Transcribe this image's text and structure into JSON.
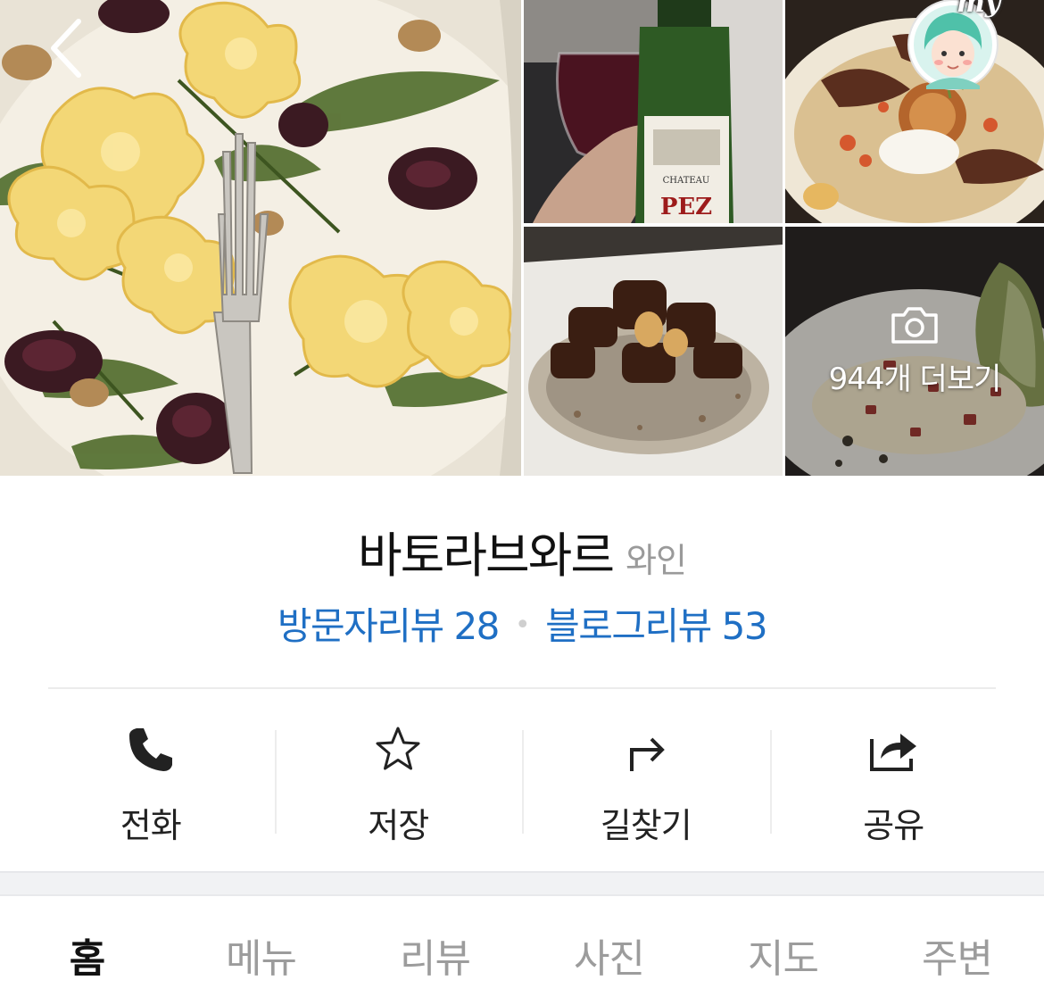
{
  "gallery": {
    "more_label": "944개 더보기"
  },
  "place": {
    "name": "바토라브와르",
    "category": "와인"
  },
  "reviews": {
    "visitor_label": "방문자리뷰 28",
    "blog_label": "블로그리뷰 53",
    "separator": "•"
  },
  "actions": [
    {
      "label": "전화",
      "icon": "phone-icon"
    },
    {
      "label": "저장",
      "icon": "star-icon"
    },
    {
      "label": "길찾기",
      "icon": "directions-icon"
    },
    {
      "label": "공유",
      "icon": "share-icon"
    }
  ],
  "tabs": [
    {
      "label": "홈",
      "active": true
    },
    {
      "label": "메뉴",
      "active": false
    },
    {
      "label": "리뷰",
      "active": false
    },
    {
      "label": "사진",
      "active": false
    },
    {
      "label": "지도",
      "active": false
    },
    {
      "label": "주변",
      "active": false
    }
  ],
  "my_badge": {
    "text": "my"
  },
  "colors": {
    "link_blue": "#1f6fc4",
    "title_text": "#111111",
    "muted_text": "#9a9a9a",
    "tab_inactive": "#9c9c9c"
  }
}
